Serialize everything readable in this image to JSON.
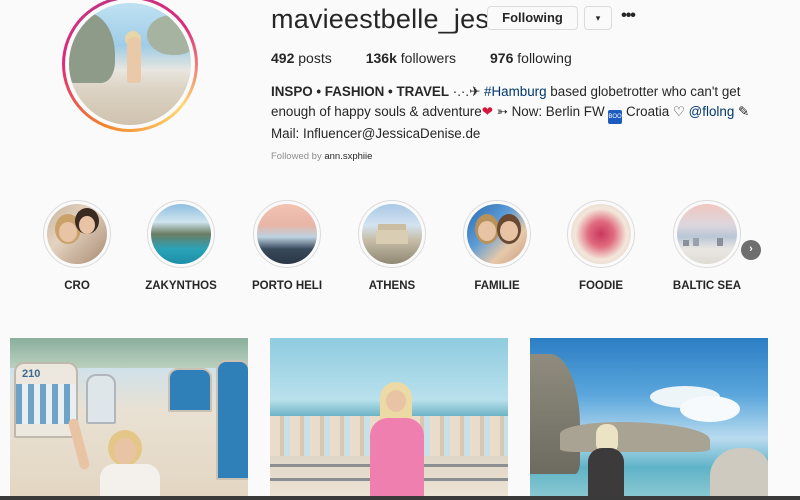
{
  "profile": {
    "username": "mavieestbelle_jessi",
    "following_button": "Following",
    "dropdown_glyph": "▾",
    "more_glyph": "•••",
    "stats": {
      "posts_count": "492",
      "posts_label": "posts",
      "followers_count": "136k",
      "followers_label": "followers",
      "following_count": "976",
      "following_label": "following"
    },
    "bio": {
      "name": "INSPO • FASHION • TRAVEL",
      "after_name": " ·.·.✈ ",
      "hashtag": "#Hamburg",
      "part2": " based globetrotter who can't get enough of happy souls & adventure",
      "heart": "❤",
      "part3": " ➳ Now: Berlin FW ",
      "badge": "BOOK",
      "part4": " Croatia ♡ ",
      "mention": "@flolng",
      "part5": " ✎ Mail: Influencer@JessicaDenise.de"
    },
    "followed_by_prefix": "Followed by ",
    "followed_by_user": "ann.sxphiie"
  },
  "highlights": [
    {
      "label": "CRO",
      "icon": "highlight-cro"
    },
    {
      "label": "ZAKYNTHOS",
      "icon": "highlight-zakynthos"
    },
    {
      "label": "PORTO HELI",
      "icon": "highlight-porto-heli"
    },
    {
      "label": "ATHENS",
      "icon": "highlight-athens"
    },
    {
      "label": "FAMILIE",
      "icon": "highlight-familie"
    },
    {
      "label": "FOODIE",
      "icon": "highlight-foodie"
    },
    {
      "label": "BALTIC SEA",
      "icon": "highlight-baltic-sea"
    }
  ],
  "highlights_next_glyph": "›",
  "posts": [
    {
      "name": "post-beach-chairs",
      "sign": "210"
    },
    {
      "name": "post-pink-dress-beach"
    },
    {
      "name": "post-coast-rocks"
    }
  ],
  "colors": {
    "link": "#00376b",
    "text": "#262626",
    "muted": "#8e8e8e",
    "border": "#dbdbdb",
    "background": "#fafafa"
  }
}
